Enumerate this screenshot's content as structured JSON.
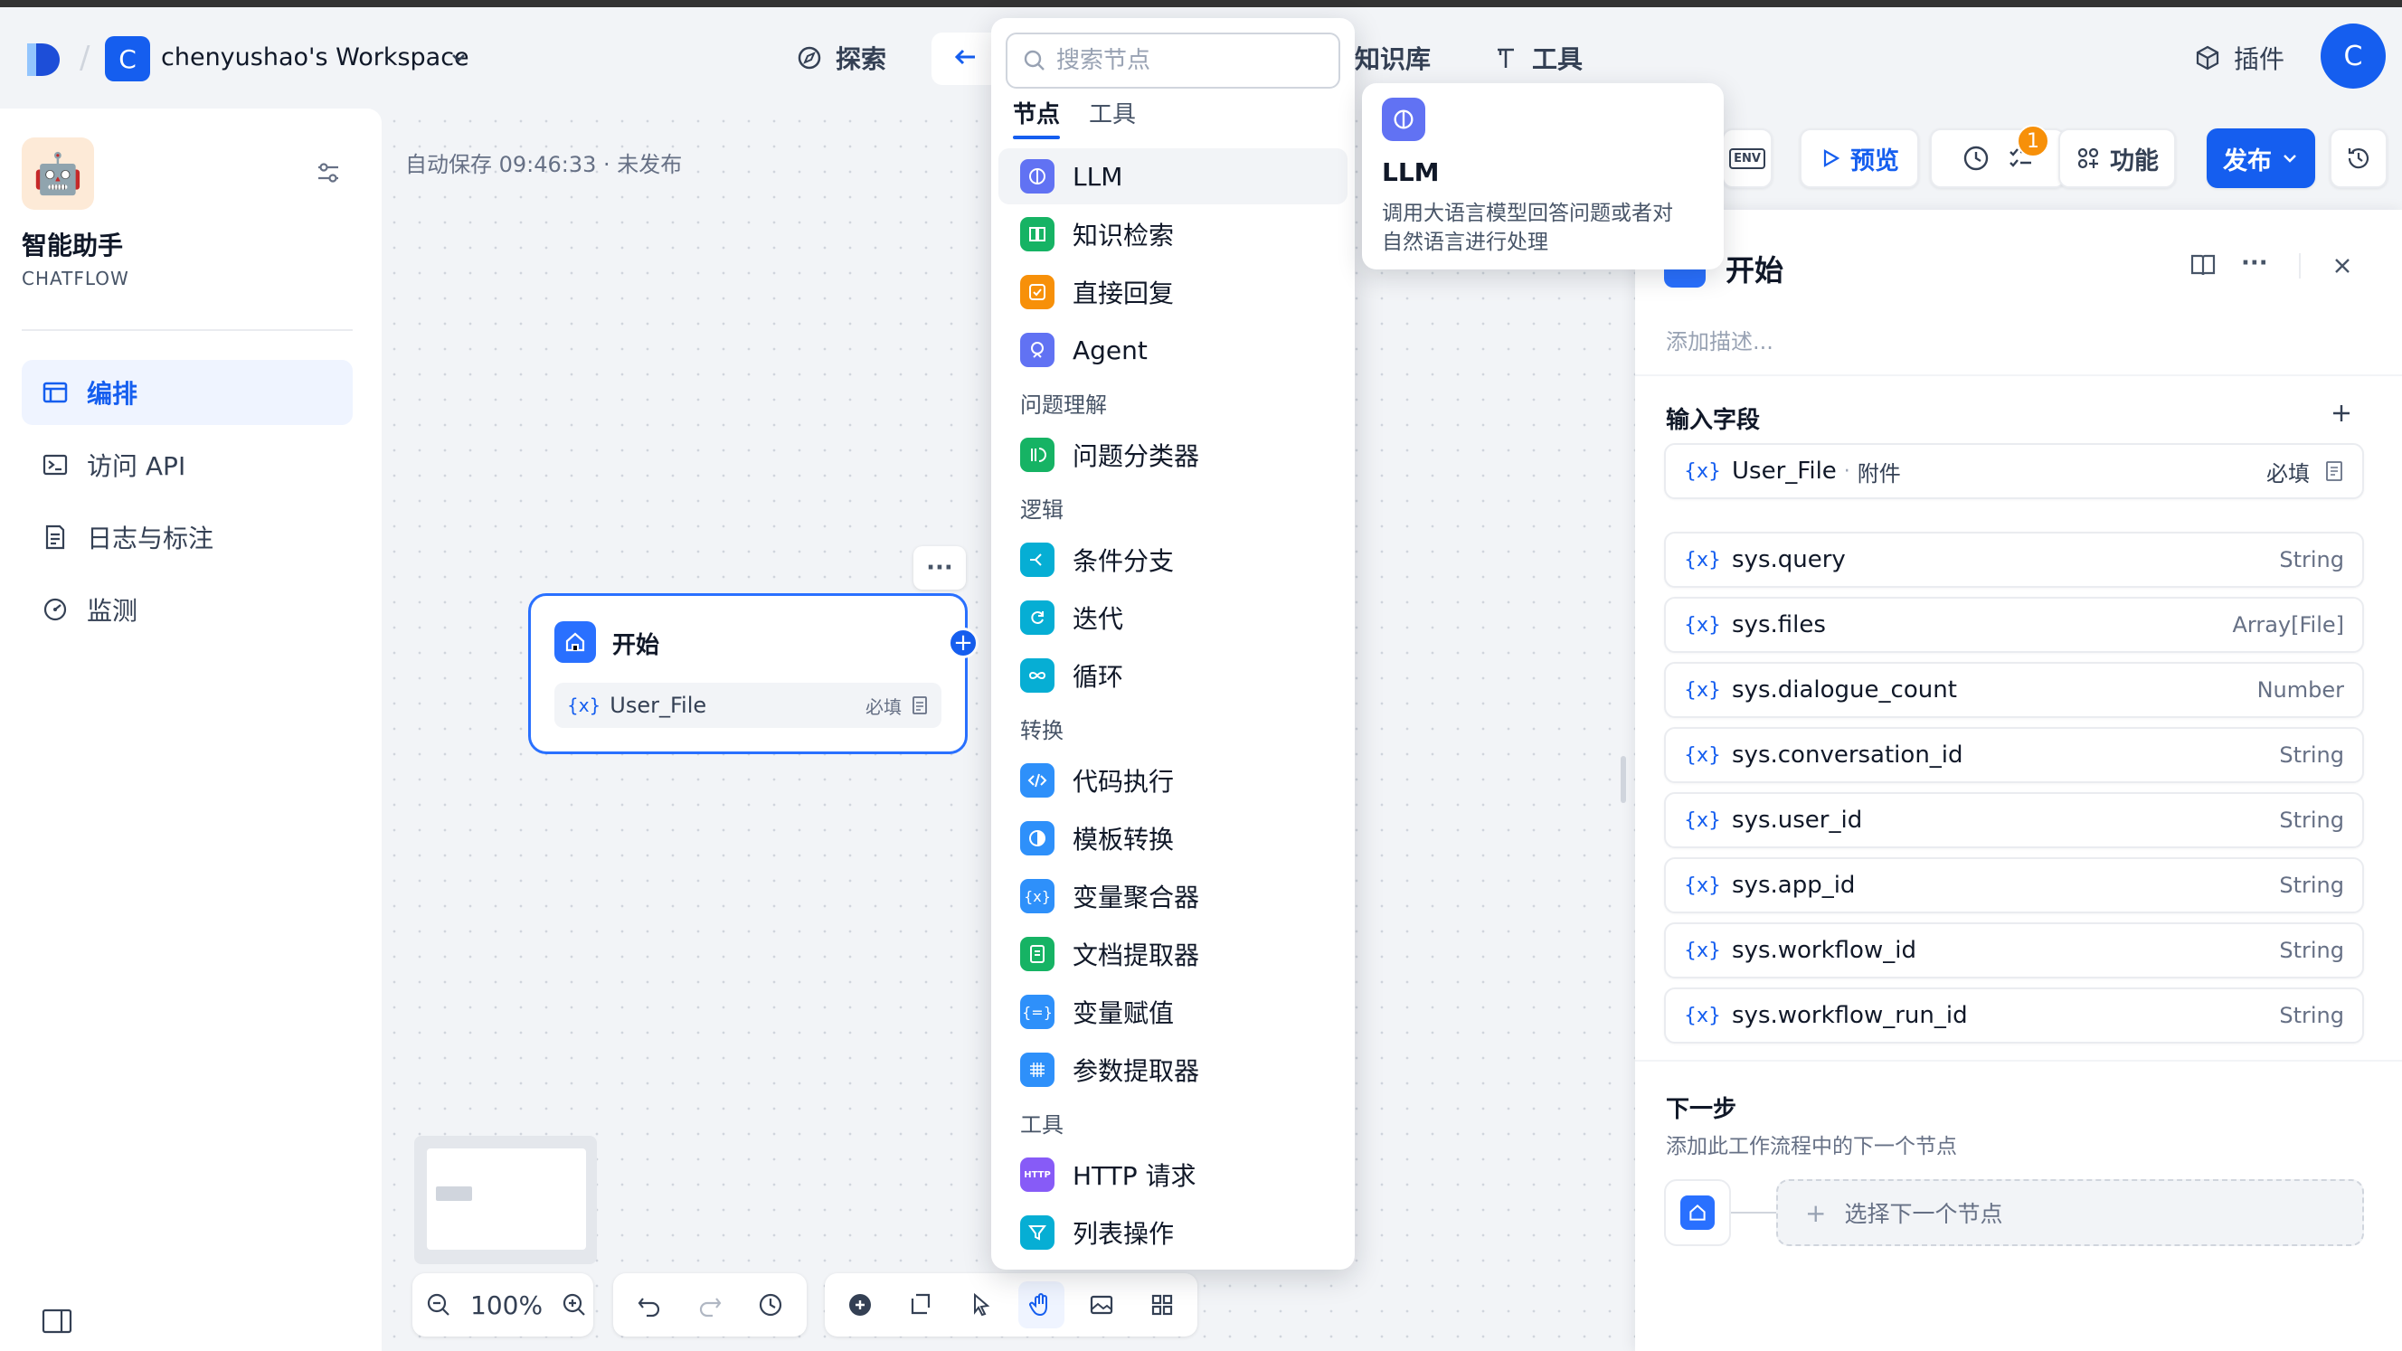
{
  "workspace": {
    "badge": "C",
    "name": "chenyushao's Workspace"
  },
  "nav": {
    "explore": "探索",
    "knowledge": "知识库",
    "tools": "工具",
    "plugins": "插件",
    "avatar": "C"
  },
  "app": {
    "icon": "robot-emoji",
    "name": "智能助手",
    "type": "CHATFLOW"
  },
  "sidebar": {
    "items": [
      {
        "label": "编排",
        "icon": "layout-icon",
        "active": true
      },
      {
        "label": "访问 API",
        "icon": "terminal-icon",
        "active": false
      },
      {
        "label": "日志与标注",
        "icon": "log-icon",
        "active": false
      },
      {
        "label": "监测",
        "icon": "monitor-icon",
        "active": false
      }
    ]
  },
  "canvas": {
    "autosave": "自动保存 09:46:33 · 未发布",
    "start_node": {
      "title": "开始",
      "var": "User_File",
      "required": "必填"
    },
    "zoom": "100%"
  },
  "dropdown": {
    "search_placeholder": "搜索节点",
    "tabs": [
      "节点",
      "工具"
    ],
    "items": [
      {
        "label": "LLM",
        "icon": "llm-icon",
        "color": "#6172f3"
      },
      {
        "label": "知识检索",
        "icon": "knowledge-icon",
        "color": "#16b364"
      },
      {
        "label": "直接回复",
        "icon": "reply-icon",
        "color": "#f79009"
      },
      {
        "label": "Agent",
        "icon": "agent-icon",
        "color": "#6172f3"
      },
      {
        "label": "问题分类器",
        "icon": "classifier-icon",
        "color": "#16b364"
      },
      {
        "label": "条件分支",
        "icon": "branch-icon",
        "color": "#06aed4"
      },
      {
        "label": "迭代",
        "icon": "iteration-icon",
        "color": "#06aed4"
      },
      {
        "label": "循环",
        "icon": "loop-icon",
        "color": "#06aed4"
      },
      {
        "label": "代码执行",
        "icon": "code-icon",
        "color": "#2e90fa"
      },
      {
        "label": "模板转换",
        "icon": "template-icon",
        "color": "#2e90fa"
      },
      {
        "label": "变量聚合器",
        "icon": "aggregator-icon",
        "color": "#2e90fa"
      },
      {
        "label": "文档提取器",
        "icon": "doc-extract-icon",
        "color": "#16b364"
      },
      {
        "label": "变量赋值",
        "icon": "assign-icon",
        "color": "#2e90fa"
      },
      {
        "label": "参数提取器",
        "icon": "param-icon",
        "color": "#2e90fa"
      },
      {
        "label": "HTTP 请求",
        "icon": "http-icon",
        "color": "#875bf7"
      },
      {
        "label": "列表操作",
        "icon": "list-filter-icon",
        "color": "#06aed4"
      }
    ],
    "groups": {
      "understanding": "问题理解",
      "logic": "逻辑",
      "transform": "转换",
      "tools": "工具"
    }
  },
  "tooltip": {
    "title": "LLM",
    "desc_line1": "调用大语言模型回答问题或者对",
    "desc_line2": "自然语言进行处理"
  },
  "header_actions": {
    "env": "ENV",
    "preview": "预览",
    "checklist_badge": "1",
    "features": "功能",
    "publish": "发布"
  },
  "panel": {
    "title": "开始",
    "desc_placeholder": "添加描述...",
    "input_title": "输入字段",
    "user_var": {
      "name": "User_File",
      "sep": "·",
      "type": "附件",
      "required": "必填"
    },
    "sys_vars": [
      {
        "name": "sys.query",
        "type": "String"
      },
      {
        "name": "sys.files",
        "type": "Array[File]"
      },
      {
        "name": "sys.dialogue_count",
        "type": "Number"
      },
      {
        "name": "sys.conversation_id",
        "type": "String"
      },
      {
        "name": "sys.user_id",
        "type": "String"
      },
      {
        "name": "sys.app_id",
        "type": "String"
      },
      {
        "name": "sys.workflow_id",
        "type": "String"
      },
      {
        "name": "sys.workflow_run_id",
        "type": "String"
      }
    ],
    "next_title": "下一步",
    "next_desc": "添加此工作流程中的下一个节点",
    "next_select": "选择下一个节点"
  },
  "colors": {
    "accent": "#155eef",
    "badge": "#f79009"
  }
}
